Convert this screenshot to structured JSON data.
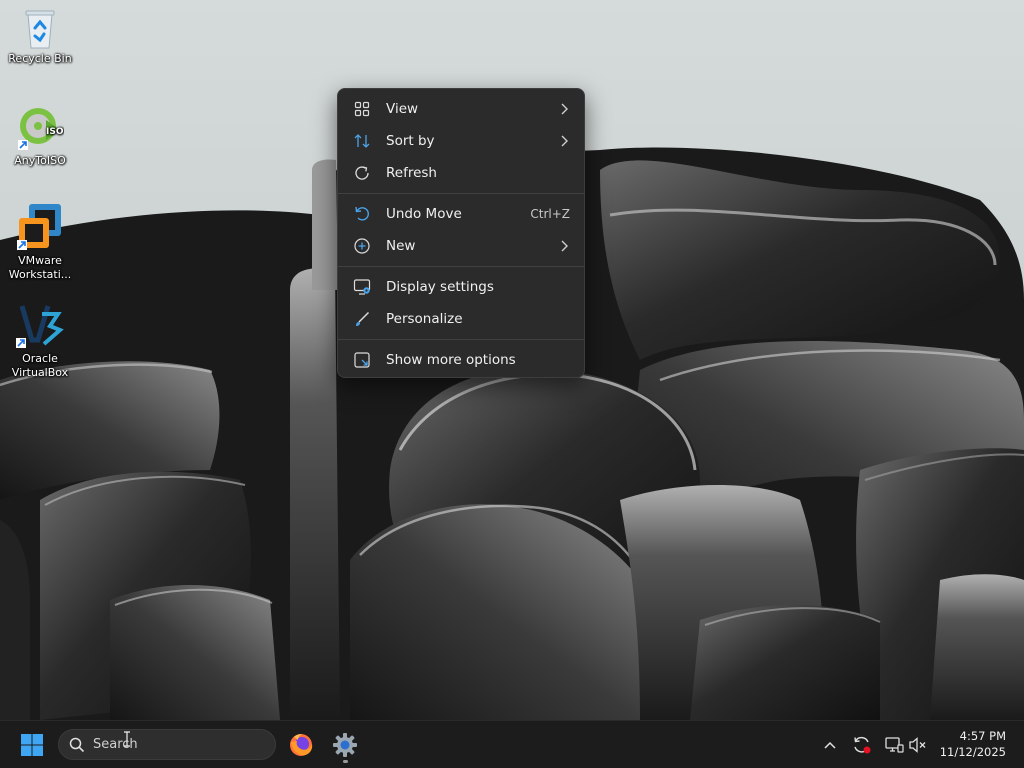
{
  "desktop_icons": [
    {
      "label": "Recycle Bin",
      "icon": "recycle-bin-icon"
    },
    {
      "label": "AnyToISO",
      "icon": "anytoiso-icon"
    },
    {
      "label": "VMware Workstati...",
      "icon": "vmware-icon"
    },
    {
      "label": "Oracle VirtualBox",
      "icon": "virtualbox-icon"
    }
  ],
  "context_menu": {
    "items": [
      {
        "label": "View",
        "icon": "grid-view-icon",
        "submenu": true
      },
      {
        "label": "Sort by",
        "icon": "sort-icon",
        "submenu": true
      },
      {
        "label": "Refresh",
        "icon": "refresh-icon"
      },
      {
        "label": "Undo Move",
        "icon": "undo-icon",
        "shortcut": "Ctrl+Z"
      },
      {
        "label": "New",
        "icon": "new-plus-icon",
        "submenu": true
      },
      {
        "label": "Display settings",
        "icon": "display-settings-icon"
      },
      {
        "label": "Personalize",
        "icon": "personalize-brush-icon"
      },
      {
        "label": "Show more options",
        "icon": "show-more-options-icon"
      }
    ]
  },
  "taskbar": {
    "search_placeholder": "Search",
    "apps": [
      {
        "name": "Firefox",
        "icon": "firefox-icon"
      },
      {
        "name": "Settings",
        "icon": "settings-gear-icon",
        "running": true
      }
    ],
    "tray": [
      "chevron-up-icon",
      "sync-alert-icon",
      "network-icon",
      "volume-muted-icon"
    ],
    "time": "4:57 PM",
    "date": "11/12/2025"
  },
  "colors": {
    "menu_bg": "#2b2b2b",
    "taskbar_bg": "#1c1c1c",
    "accent": "#4aa3e8",
    "alert": "#e81123"
  }
}
